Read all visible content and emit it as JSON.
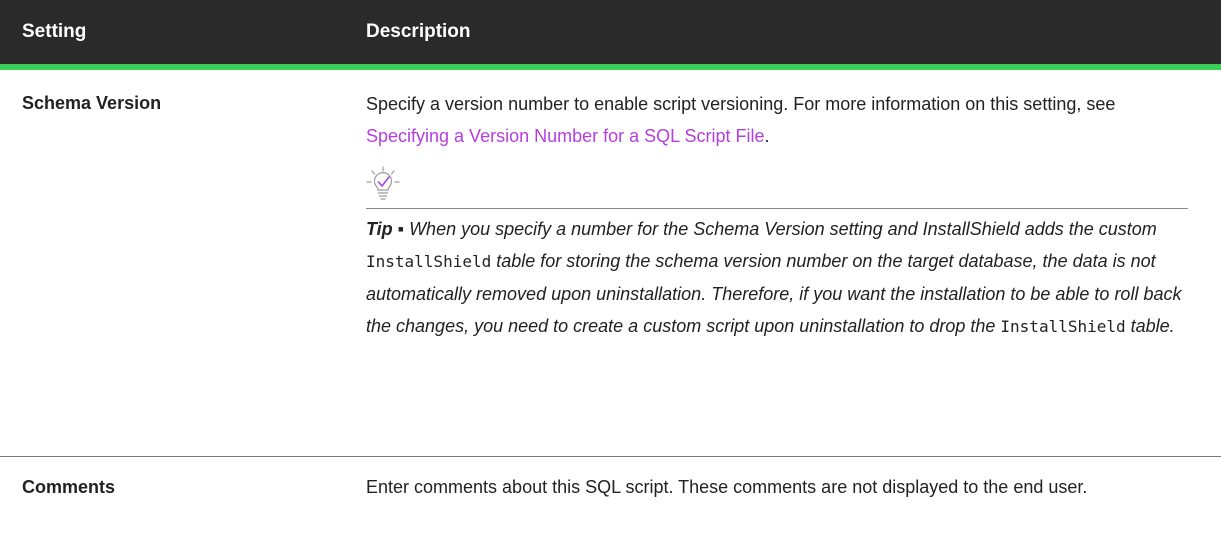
{
  "table": {
    "headers": [
      "Setting",
      "Description"
    ],
    "rows": [
      {
        "setting": "Schema Version",
        "desc_pre": "Specify a version number to enable script versioning. For more information on this setting, see ",
        "desc_link": "Specifying a Version Number for a SQL Script File",
        "desc_post": ".",
        "tip": {
          "label": "Tip",
          "bullet": " ▪ ",
          "text_a": "When you specify a number for the Schema Version setting and InstallShield adds the custom ",
          "code_a": "InstallShield",
          "text_b": " table for storing the schema version number on the target database, the data is not automatically removed upon uninstallation. Therefore, if you want the installation to be able to roll back the changes, you need to create a custom script upon uninstallation to drop the ",
          "code_b": "InstallShield",
          "text_c": " table."
        }
      },
      {
        "setting": "Comments",
        "desc": "Enter comments about this SQL script. These comments are not displayed to the end user."
      }
    ]
  },
  "colors": {
    "header_bg": "#2a2a2a",
    "header_accent": "#3dd15c",
    "link": "#b43fe0",
    "tip_icon": "#9b59b6"
  }
}
